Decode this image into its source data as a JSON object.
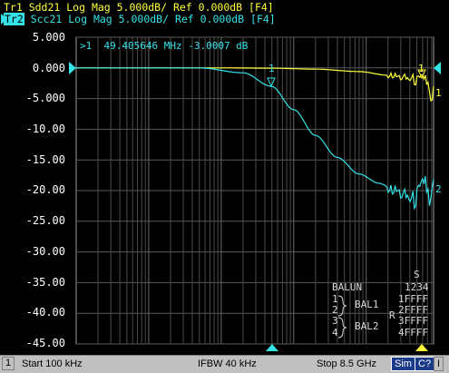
{
  "traces": {
    "tr1": {
      "id": "Tr1",
      "text": " Sdd21 Log Mag 5.000dB/ Ref 0.000dB [F4]",
      "color": "#ffff3c"
    },
    "tr2": {
      "id": "Tr2",
      "text": " Scc21 Log Mag 5.000dB/ Ref 0.000dB [F4]",
      "color": "#34e3e8"
    }
  },
  "marker_readout": ">1  49.405646 MHz -3.0007 dB",
  "marker_labels": {
    "tr1_marker": "1",
    "tr2_marker": "1",
    "tr1_end": "1",
    "tr2_end": "2"
  },
  "y_axis": {
    "ticks": [
      "5.000",
      "0.000",
      "-5.000",
      "-10.00",
      "-15.00",
      "-20.00",
      "-25.00",
      "-30.00",
      "-35.00",
      "-40.00",
      "-45.00"
    ],
    "min": -45,
    "max": 5
  },
  "balun": {
    "title": "BALUN",
    "s_label": "S",
    "ports_header": "1234",
    "rows": [
      "1FFFF",
      "2FFFF",
      "3FFFF",
      "4FFFF"
    ],
    "bal1": "BAL1",
    "bal2": "BAL2",
    "r_label": "R",
    "port_nums": [
      "1",
      "2",
      "3",
      "4"
    ]
  },
  "status_bar": {
    "channel": "1",
    "start": "Start 100 kHz",
    "ifbw": "IFBW 40 kHz",
    "stop": "Stop 8.5 GHz",
    "sim": "Sim",
    "c2": "C?",
    "i": "I"
  },
  "chart_data": {
    "type": "line",
    "x_scale": "log",
    "xlim_hz": [
      100000,
      8500000000
    ],
    "ylim": [
      -45,
      5
    ],
    "series": [
      {
        "name": "Sdd21",
        "color": "#ffff3c",
        "x_hz": [
          100000,
          1000000,
          10000000,
          49405646,
          200000000,
          800000000,
          2000000000,
          4000000000,
          5500000000,
          6500000000,
          7000000000,
          7500000000,
          8000000000,
          8500000000
        ],
        "y": [
          0.0,
          0.0,
          0.0,
          -0.05,
          -0.2,
          -0.6,
          -1.2,
          -1.8,
          -2.2,
          -1.4,
          -2.5,
          -4.5,
          -6.5,
          -4.0
        ]
      },
      {
        "name": "Scc21",
        "color": "#34e3e8",
        "x_hz": [
          100000,
          1000000,
          5000000,
          20000000,
          49405646,
          100000000,
          200000000,
          400000000,
          800000000,
          1500000000,
          2500000000,
          3500000000,
          4500000000,
          5500000000,
          6500000000,
          7000000000,
          7500000000,
          8000000000,
          8500000000
        ],
        "y": [
          0.0,
          0.0,
          0.0,
          -0.8,
          -3.0,
          -6.8,
          -11.0,
          -14.6,
          -17.3,
          -18.8,
          -20.0,
          -21.0,
          -21.6,
          -20.5,
          -18.0,
          -20.0,
          -23.5,
          -21.0,
          -20.0
        ]
      }
    ]
  }
}
